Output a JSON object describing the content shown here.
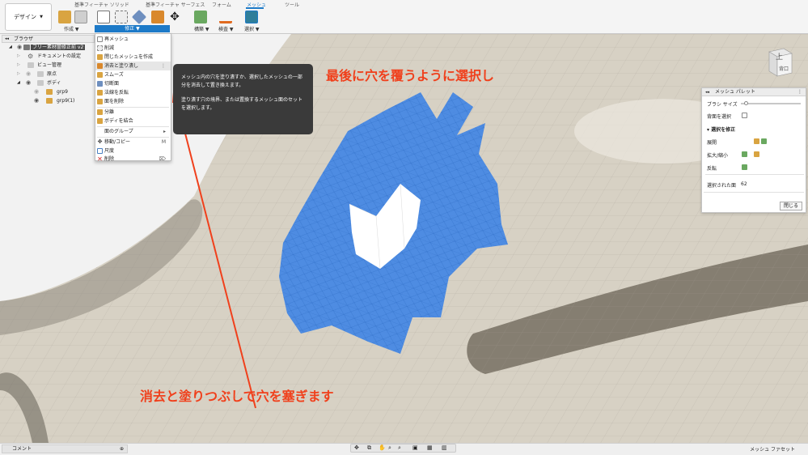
{
  "tabs": [
    {
      "label": "基準フィーチャ ソリッド",
      "active": false
    },
    {
      "label": "基準フィーチャ サーフェス",
      "active": false
    },
    {
      "label": "フォーム",
      "active": false
    },
    {
      "label": "メッシュ",
      "active": true
    },
    {
      "label": "ツール",
      "active": false
    }
  ],
  "design_button": {
    "label": "デザイン",
    "caret": "▼"
  },
  "toolbar_groups": {
    "create": "作成 ▼",
    "modify": "修正 ▼",
    "construct": "構築 ▼",
    "inspect": "検査 ▼",
    "select": "選択 ▼"
  },
  "browser": {
    "header": "ブラウザ",
    "items": [
      {
        "label": "フリー素材箇修正前 v2",
        "icon": "component-icon"
      },
      {
        "label": "ドキュメントの設定",
        "icon": "gear-icon"
      },
      {
        "label": "ビュー管理",
        "icon": "folder-icon"
      },
      {
        "label": "原点",
        "icon": "folder-icon"
      },
      {
        "label": "ボディ",
        "icon": "folder-icon"
      },
      {
        "label": "grp9",
        "icon": "mesh-body-icon"
      },
      {
        "label": "grp9(1)",
        "icon": "mesh-body-icon"
      }
    ]
  },
  "menu": {
    "items": [
      {
        "label": "再メッシュ",
        "icon": "remesh-icon"
      },
      {
        "label": "削減",
        "icon": "reduce-icon"
      },
      {
        "label": "閉じたメッシュを作成",
        "icon": "make-closed-mesh-icon"
      },
      {
        "label": "消去と塗り潰し",
        "icon": "erase-fill-icon",
        "highlighted": true
      },
      {
        "label": "スムーズ",
        "icon": "smooth-icon"
      },
      {
        "label": "切断面",
        "icon": "plane-cut-icon"
      },
      {
        "label": "法線を反転",
        "icon": "reverse-normal-icon"
      },
      {
        "label": "面を削除",
        "icon": "delete-faces-icon"
      },
      {
        "label": "分離",
        "icon": "separate-icon"
      },
      {
        "label": "ボディを結合",
        "icon": "combine-icon"
      },
      {
        "label": "面のグループ",
        "icon": "",
        "submenu": true
      },
      {
        "label": "移動/コピー",
        "icon": "move-icon",
        "shortcut": "M"
      },
      {
        "label": "尺度",
        "icon": "scale-icon"
      },
      {
        "label": "削除",
        "icon": "delete-icon",
        "shortcut": "⌦"
      }
    ]
  },
  "tooltip": {
    "p1": "メッシュ内の穴を塗り潰すか、選択したメッシュの一部分を消去して置き換えます。",
    "p2": "塗り潰す穴の境界、または置換するメッシュ面のセットを選択します。"
  },
  "annotations": {
    "top": "最後に穴を覆うように選択し",
    "bottom": "消去と塗りつぶしで穴を塞ぎます",
    "color": "#f0401c"
  },
  "palette": {
    "title": "メッシュ パレット",
    "brush_size_label": "ブラシ サイズ",
    "brush_size": 0.05,
    "select_through_label": "背面を選択",
    "modify_section": "選択を修正",
    "expand_label": "展開",
    "grow_shrink_label": "拡大/縮小",
    "invert_label": "反転",
    "selected_faces_label": "選択された面",
    "selected_faces_count": "62",
    "close_button": "閉じる"
  },
  "viewcube": {
    "top": "上",
    "front": "背口"
  },
  "bottom": {
    "comment_label": "コメント",
    "status_right": "メッシュ ファセット"
  },
  "colors": {
    "accent": "#1d7ac8",
    "selection": "#3b82e6",
    "surface": "#d8d4cc"
  }
}
